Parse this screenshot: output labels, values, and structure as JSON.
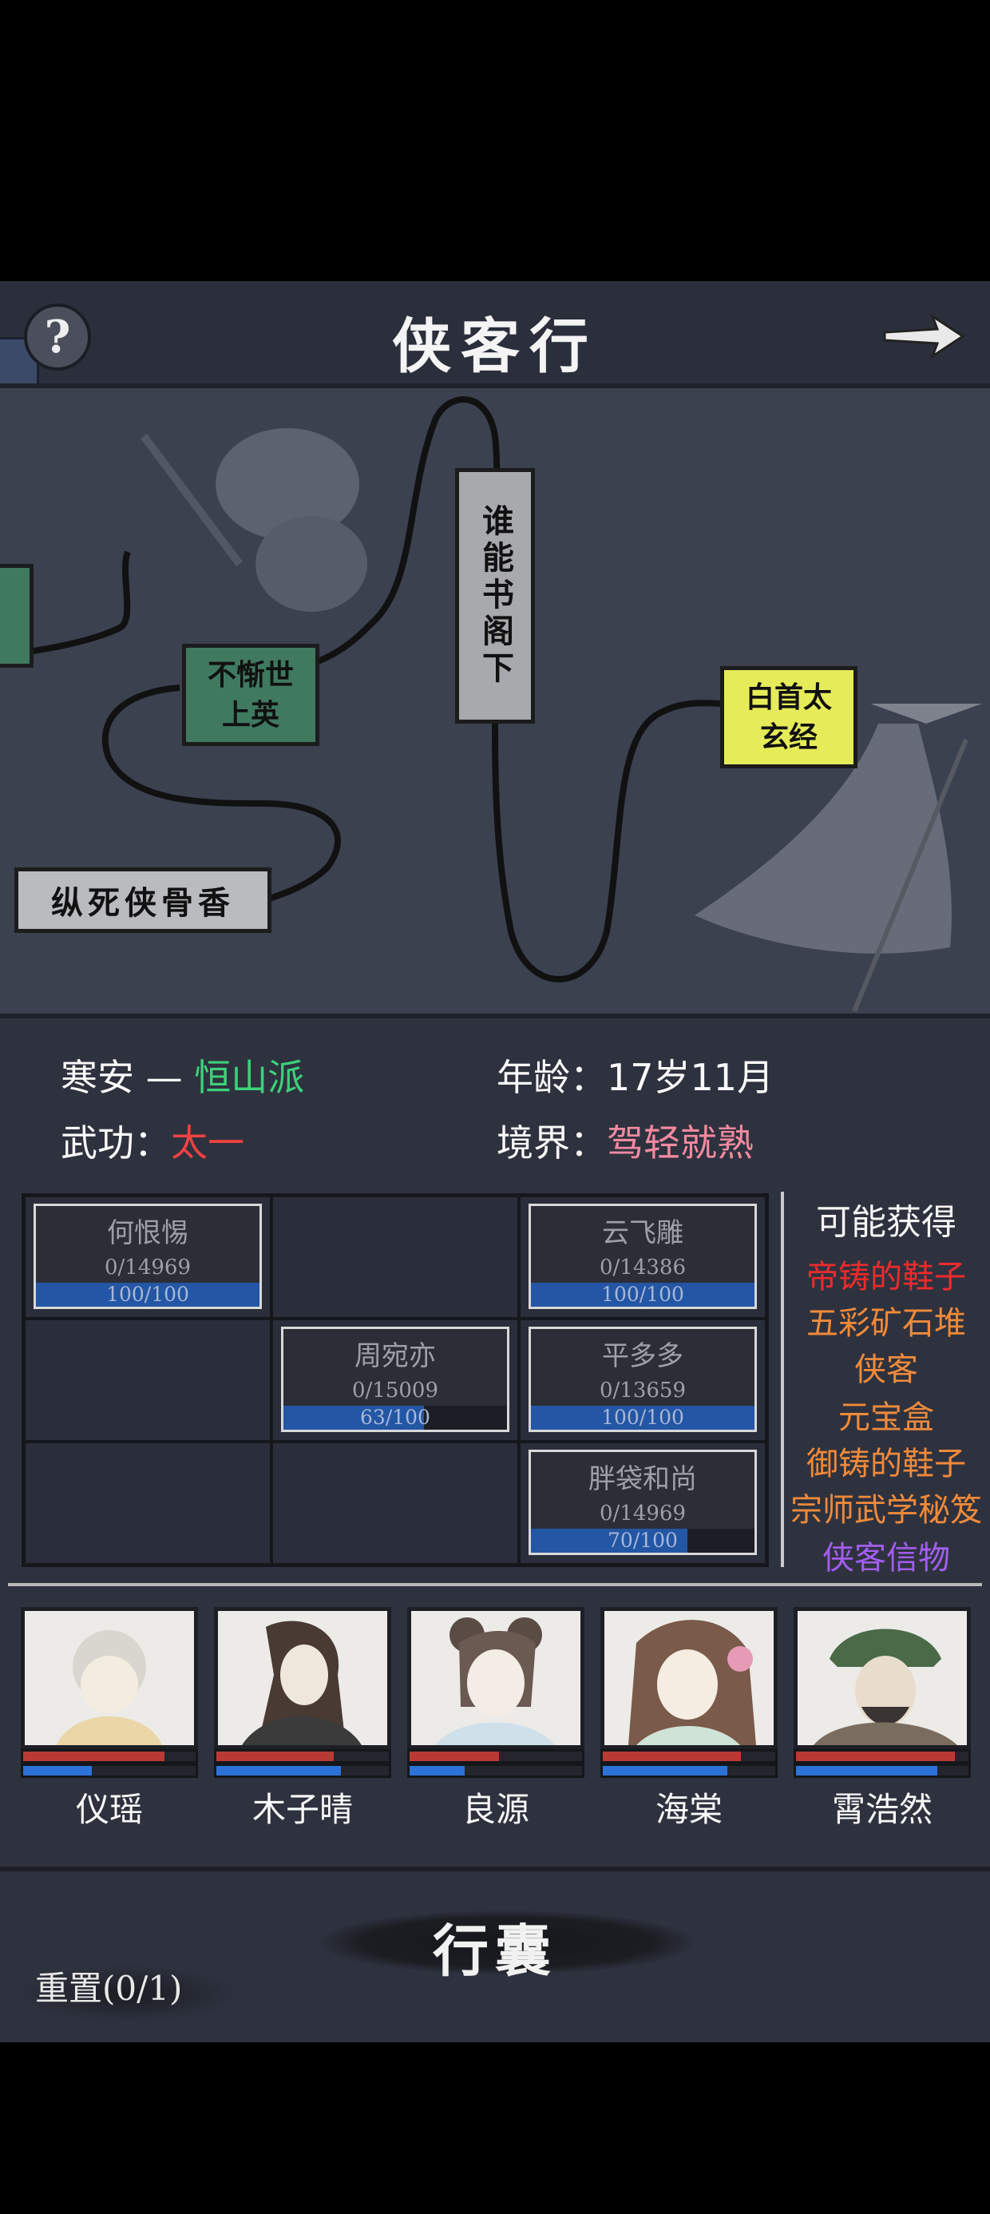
{
  "header": {
    "title": "侠客行",
    "help_icon": "question-icon",
    "next_icon": "arrow-right-icon"
  },
  "map": {
    "nodes": [
      {
        "id": "n1",
        "label": "纵死侠骨香",
        "color": "white"
      },
      {
        "id": "n2",
        "label": "不惭世上英",
        "color": "green"
      },
      {
        "id": "n3",
        "label": "谁能书阁下",
        "color": "gray"
      },
      {
        "id": "n4",
        "label": "白首太玄经",
        "color": "yellow"
      },
      {
        "id": "n5",
        "label": "",
        "color": "green"
      }
    ]
  },
  "info": {
    "name": "寒安",
    "dash": "—",
    "sect": "恒山派",
    "age_label": "年龄：",
    "age_value": "17岁11月",
    "skill_label": "武功：",
    "skill_value": "太一",
    "realm_label": "境界：",
    "realm_value": "驾轻就熟"
  },
  "grid": [
    {
      "name": "何恨惕",
      "exp": "0/14969",
      "bar_text": "100/100",
      "fill": 1.0
    },
    null,
    {
      "name": "云飞雕",
      "exp": "0/14386",
      "bar_text": "100/100",
      "fill": 1.0
    },
    null,
    {
      "name": "周宛亦",
      "exp": "0/15009",
      "bar_text": "63/100",
      "fill": 0.63
    },
    {
      "name": "平多多",
      "exp": "0/13659",
      "bar_text": "100/100",
      "fill": 1.0
    },
    null,
    null,
    {
      "name": "胖袋和尚",
      "exp": "0/14969",
      "bar_text": "70/100",
      "fill": 0.7
    }
  ],
  "rewards": {
    "title": "可能获得",
    "items": [
      {
        "label": "帝铸的鞋子",
        "color": "#ee2b2b"
      },
      {
        "label": "五彩矿石堆",
        "color": "#f08a3a"
      },
      {
        "label": "侠客",
        "color": "#f08a3a"
      },
      {
        "label": "元宝盒",
        "color": "#f08a3a"
      },
      {
        "label": "御铸的鞋子",
        "color": "#f08a3a"
      },
      {
        "label": "宗师武学秘笈",
        "color": "#f08a3a"
      },
      {
        "label": "侠客信物",
        "color": "#a35df0"
      }
    ]
  },
  "party": [
    {
      "name": "仪瑶",
      "hp": 0.82,
      "mp": 0.4
    },
    {
      "name": "木子晴",
      "hp": 0.68,
      "mp": 0.72
    },
    {
      "name": "良源",
      "hp": 0.52,
      "mp": 0.32
    },
    {
      "name": "海棠",
      "hp": 0.8,
      "mp": 0.72
    },
    {
      "name": "霄浩然",
      "hp": 0.92,
      "mp": 0.82
    }
  ],
  "footer": {
    "bag_label": "行囊",
    "reset_label": "重置(0/1)"
  }
}
